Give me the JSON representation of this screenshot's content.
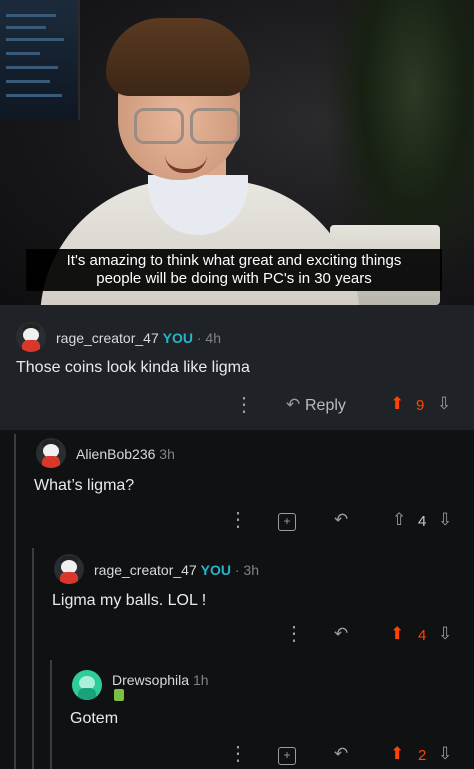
{
  "meme": {
    "caption_line1": "It's amazing to think what great and exciting things",
    "caption_line2": "people will be doing with PC's in 30 years"
  },
  "comments": [
    {
      "user": "rage_creator_47",
      "badge": "YOU",
      "time": "· 4h",
      "text": "Those coins look kinda like ligma",
      "reply_label": "Reply",
      "score": "9",
      "voted": "up"
    },
    {
      "user": "AlienBob236",
      "time": "3h",
      "text": "What’s ligma?",
      "score": "4",
      "voted": "none"
    },
    {
      "user": "rage_creator_47",
      "badge": "YOU",
      "time": "· 3h",
      "text": "Ligma my balls.  LOL !",
      "score": "4",
      "voted": "up"
    },
    {
      "user": "Drewsophila",
      "time": "1h",
      "text": "Gotem",
      "score": "2",
      "voted": "up"
    }
  ],
  "icons": {
    "more": "more-dots-icon",
    "reply": "reply-arrow-icon",
    "award": "award-gift-icon",
    "upvote": "upvote-arrow-icon",
    "downvote": "downvote-arrow-icon"
  },
  "colors": {
    "upvote_active": "#ff4500",
    "you_badge": "#23b6c8",
    "highlight_bg": "#1f2327",
    "thread_bg": "#101112"
  }
}
